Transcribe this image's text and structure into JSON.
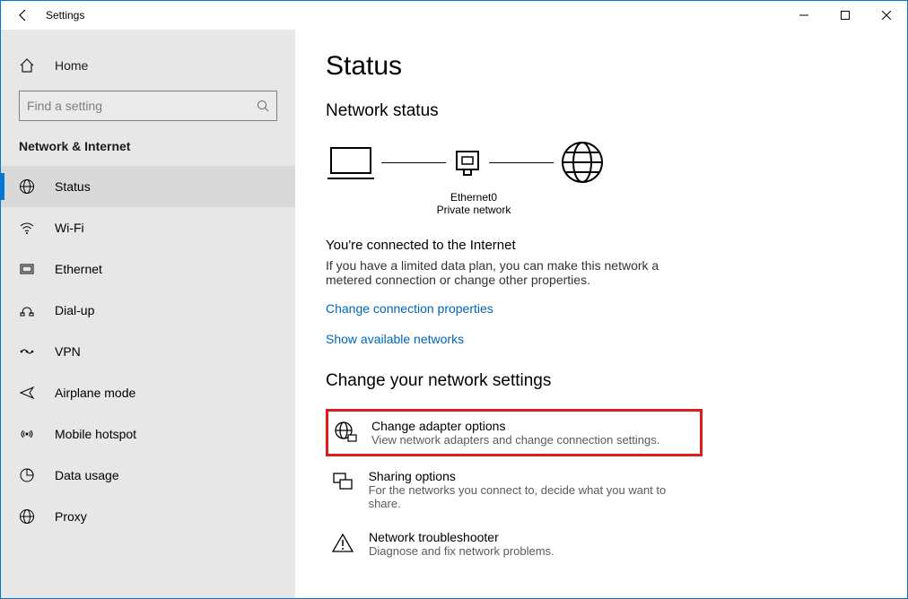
{
  "window": {
    "title": "Settings"
  },
  "sidebar": {
    "home_label": "Home",
    "search_placeholder": "Find a setting",
    "section": "Network & Internet",
    "items": [
      {
        "label": "Status"
      },
      {
        "label": "Wi-Fi"
      },
      {
        "label": "Ethernet"
      },
      {
        "label": "Dial-up"
      },
      {
        "label": "VPN"
      },
      {
        "label": "Airplane mode"
      },
      {
        "label": "Mobile hotspot"
      },
      {
        "label": "Data usage"
      },
      {
        "label": "Proxy"
      }
    ]
  },
  "main": {
    "title": "Status",
    "subtitle": "Network status",
    "diagram_adapter": "Ethernet0",
    "diagram_type": "Private network",
    "lead": "You're connected to the Internet",
    "desc": "If you have a limited data plan, you can make this network a metered connection or change other properties.",
    "link1": "Change connection properties",
    "link2": "Show available networks",
    "change_heading": "Change your network settings",
    "options": [
      {
        "title": "Change adapter options",
        "sub": "View network adapters and change connection settings."
      },
      {
        "title": "Sharing options",
        "sub": "For the networks you connect to, decide what you want to share."
      },
      {
        "title": "Network troubleshooter",
        "sub": "Diagnose and fix network problems."
      }
    ]
  }
}
